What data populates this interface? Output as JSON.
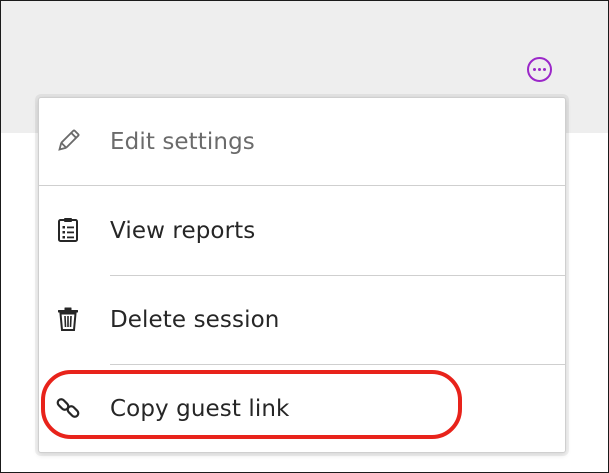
{
  "header": {
    "more_button_label": "More options",
    "accent_color": "#9b27c9"
  },
  "menu": {
    "items": [
      {
        "label": "Edit settings",
        "icon": "pencil-icon",
        "disabled": true
      },
      {
        "label": "View reports",
        "icon": "clipboard-report-icon",
        "disabled": false
      },
      {
        "label": "Delete session",
        "icon": "trash-icon",
        "disabled": false
      },
      {
        "label": "Copy guest link",
        "icon": "link-icon",
        "disabled": false,
        "highlighted": true
      }
    ]
  },
  "highlight_color": "#e8231b"
}
